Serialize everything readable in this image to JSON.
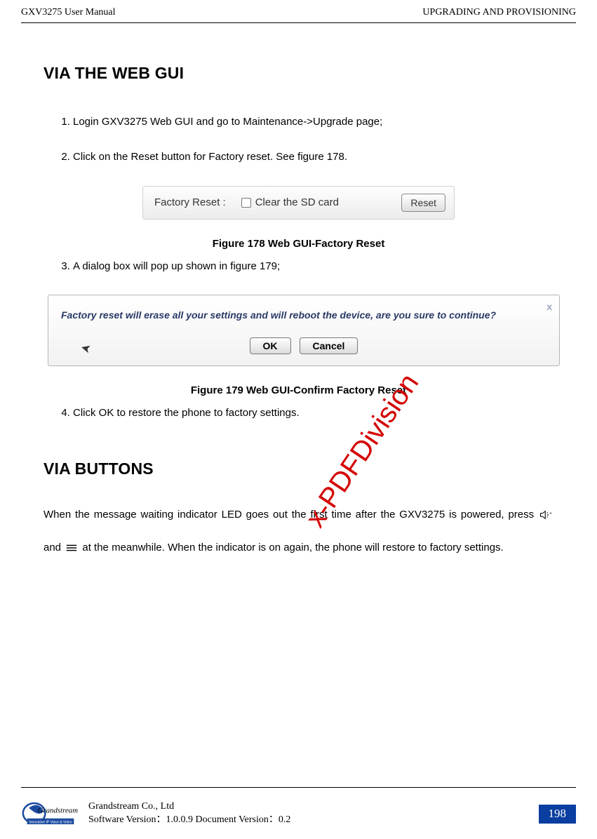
{
  "header": {
    "left": "GXV3275 User Manual",
    "right": "UPGRADING AND PROVISIONING"
  },
  "section1": {
    "title": "VIA THE WEB GUI",
    "step1": "Login GXV3275 Web GUI and go to Maintenance->Upgrade page;",
    "step2": "Click on the Reset button for Factory reset. See figure 178.",
    "step3": "A dialog box will pop up shown in figure 179;",
    "step4": "Click OK to restore the phone to factory settings."
  },
  "fig178": {
    "label": "Factory Reset :",
    "checkbox_label": "Clear the SD card",
    "button": "Reset",
    "caption": "Figure 178 Web GUI-Factory Reset"
  },
  "fig179": {
    "text": "Factory reset will erase all your settings and will reboot the device, are you sure to continue?",
    "ok": "OK",
    "cancel": "Cancel",
    "close": "x",
    "caption": "Figure 179 Web GUI-Confirm Factory Reset"
  },
  "section2": {
    "title": "VIA BUTTONS",
    "body_pre": "When the message waiting indicator LED goes out the first time after the GXV3275 is powered, press ",
    "body_mid": " and ",
    "body_post": " at the meanwhile. When the indicator is on again, the phone will restore to factory settings."
  },
  "watermark": "x-PDFDivision",
  "footer": {
    "company": "Grandstream Co., Ltd",
    "version": "Software Version：1.0.0.9 Document Version：0.2",
    "page": "198"
  }
}
